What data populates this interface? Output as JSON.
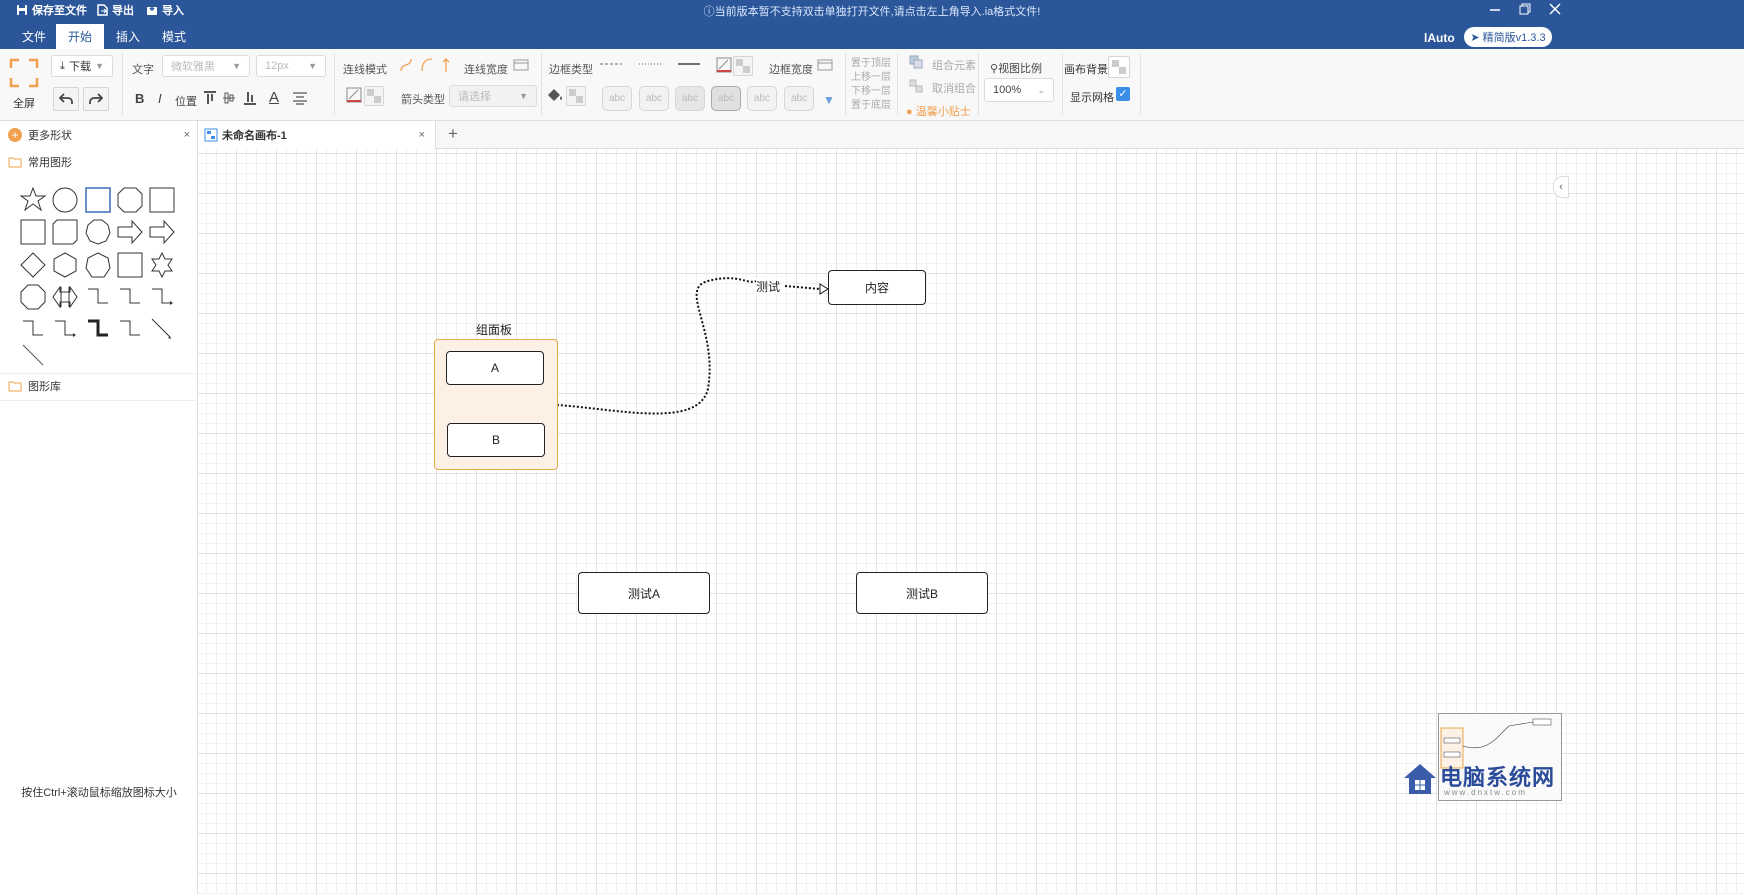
{
  "topbar": {
    "save_label": "保存至文件",
    "export_label": "导出",
    "import_label": "导入",
    "notice": "当前版本暂不支持双击单独打开文件,请点击左上角导入.ia格式文件!",
    "menus": [
      "文件",
      "开始",
      "插入",
      "模式"
    ],
    "active_menu": "开始",
    "user": "lAuto",
    "version": "精简版v1.3.3"
  },
  "ribbon": {
    "fullscreen": "全屏",
    "download": "下载",
    "text_label": "文字",
    "font_value": "微软雅黑",
    "font_size": "12px",
    "bold": "B",
    "italic": "I",
    "position": "位置",
    "line_mode": "连线模式",
    "line_width": "连线宽度",
    "arrow_type": "箭头类型",
    "arrow_placeholder": "请选择",
    "border_type": "边框类型",
    "border_width": "边框宽度",
    "abc": [
      "abc",
      "abc",
      "abc",
      "abc",
      "abc",
      "abc"
    ],
    "layers": [
      "置于顶层",
      "上移一层",
      "下移一层",
      "置于底层"
    ],
    "group": "组合元素",
    "ungroup": "取消组合",
    "tip": "温馨小贴士",
    "zoom_label": "视图比例",
    "zoom_value": "100%",
    "canvas_bg": "画布背景",
    "show_grid": "显示网格",
    "show_grid_checked": true
  },
  "sidebar": {
    "more_shapes": "更多形状",
    "common_shapes": "常用图形",
    "shape_library": "图形库",
    "hint": "按住Ctrl+滚动鼠标缩放图标大小",
    "shapes": [
      "star",
      "circle",
      "rectangle",
      "octagon-rect",
      "square",
      "square",
      "rounded-square",
      "decagon",
      "right-arrow",
      "right-arrow",
      "diamond",
      "hexagon",
      "heptagon",
      "square",
      "six-point-star",
      "octagon",
      "double-arrow",
      "step-connector",
      "step-connector",
      "step-connector-arrow",
      "step-connector",
      "step-connector-arrow",
      "thick-step-connector",
      "step-connector",
      "diagonal-arrow",
      "diagonal-line"
    ]
  },
  "tabs": [
    {
      "label": "未命名画布-1"
    }
  ],
  "canvas": {
    "group_title": "组面板",
    "node_a": "A",
    "node_b": "B",
    "node_content": "内容",
    "edge_label": "测试",
    "node_test_a": "测试A",
    "node_test_b": "测试B"
  },
  "watermark": {
    "title": "电脑系统网",
    "url": "www.dnxtw.com"
  },
  "colors": {
    "topbar": "#2b579a",
    "accent_orange": "#f0ad4e",
    "group_fill": "#fdf1e6"
  }
}
